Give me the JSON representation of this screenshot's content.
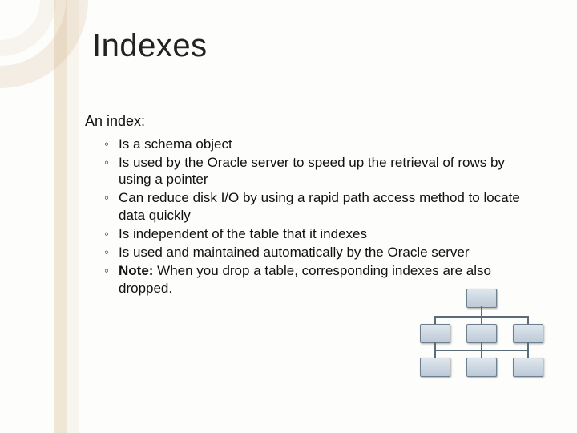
{
  "title": "Indexes",
  "intro": "An index:",
  "bullets": [
    {
      "text": "Is a schema object"
    },
    {
      "text": "Is used by the Oracle server to speed up the retrieval of rows by using a pointer"
    },
    {
      "text": "Can reduce disk I/O by using a rapid path access method to locate data quickly"
    },
    {
      "text": "Is independent of the table that it indexes"
    },
    {
      "text": "Is used and maintained automatically by the Oracle server"
    },
    {
      "note_label": "Note:",
      "text": " When you drop a table, corresponding indexes are also dropped."
    }
  ],
  "icon": "org-chart-icon"
}
